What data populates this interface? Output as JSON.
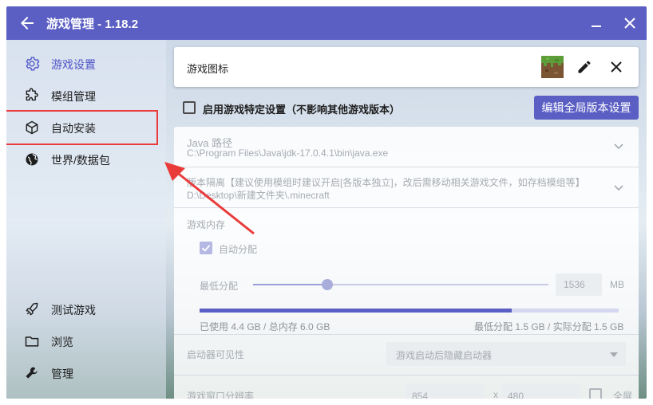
{
  "window": {
    "title": "游戏管理 - 1.18.2",
    "accent_color": "#5b5fc4",
    "highlight_color": "#ea3b3b"
  },
  "titlebar_icons": [
    "back-arrow-icon",
    "minimize-icon",
    "close-icon"
  ],
  "sidebar": {
    "items": [
      {
        "label": "游戏设置",
        "icon": "gear-icon",
        "active": true
      },
      {
        "label": "模组管理",
        "icon": "puzzle-icon",
        "active": false
      },
      {
        "label": "自动安装",
        "icon": "cube-icon",
        "active": false
      },
      {
        "label": "世界/数据包",
        "icon": "globe-icon",
        "active": false
      }
    ],
    "bottom_items": [
      {
        "label": "测试游戏",
        "icon": "rocket-icon"
      },
      {
        "label": "浏览",
        "icon": "folder-icon"
      },
      {
        "label": "管理",
        "icon": "wrench-icon"
      }
    ]
  },
  "icon_card": {
    "label": "游戏图标",
    "icons": [
      "grass-block-icon",
      "pencil-icon",
      "close-icon"
    ]
  },
  "specific_settings": {
    "label": "启用游戏特定设置（不影响其他游戏版本）",
    "checked": false
  },
  "global_button": {
    "label": "编辑全局版本设置"
  },
  "java": {
    "title": "Java 路径",
    "value": "C:\\Program Files\\Java\\jdk-17.0.4.1\\bin\\java.exe"
  },
  "isolation": {
    "title": "版本隔离【建议使用模组时建议开启[各版本独立]，改后需移动相关游戏文件，如存档模组等】",
    "value": "D:\\Desktop\\新建文件夹\\.minecraft"
  },
  "memory": {
    "title": "游戏内存",
    "auto_label": "自动分配",
    "auto_checked": true,
    "min_label": "最低分配",
    "min_value": "1536",
    "min_unit": "MB",
    "slider_fraction": 0.25,
    "usage_fraction": 0.745,
    "used_text": "已使用 4.4 GB / 总内存 6.0 GB",
    "alloc_text": "最低分配 1.5 GB / 实际分配 1.5 GB"
  },
  "launcher_visibility": {
    "label": "启动器可见性",
    "selected": "游戏启动后隐藏启动器"
  },
  "resolution": {
    "label": "游戏窗口分辨率",
    "width": "854",
    "separator": "x",
    "height": "480",
    "fullscreen_label": "全屏"
  }
}
